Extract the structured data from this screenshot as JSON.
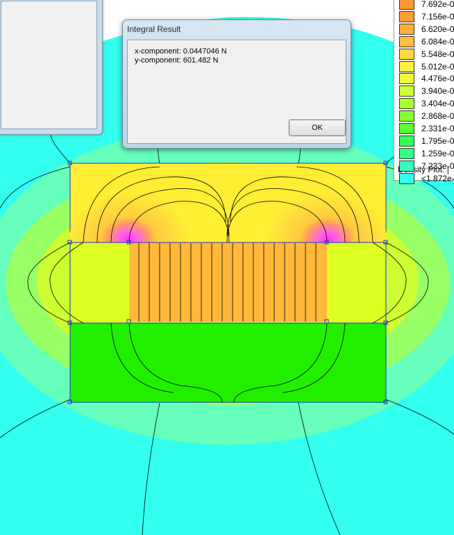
{
  "dialog": {
    "title": "Integral Result",
    "x_component": "x-component: 0.0447046 N",
    "y_component": "y-component: 601.482 N",
    "ok_label": "OK"
  },
  "legend": {
    "title": "Density Plot: |",
    "entries": [
      {
        "label": "7.692e-0",
        "color": "#ff9933"
      },
      {
        "label": "7.156e-0",
        "color": "#ffa033"
      },
      {
        "label": "6.620e-0",
        "color": "#ffae3a"
      },
      {
        "label": "6.084e-0",
        "color": "#ffc040"
      },
      {
        "label": "5.548e-0",
        "color": "#ffd840"
      },
      {
        "label": "5.012e-0",
        "color": "#fff040"
      },
      {
        "label": "4.476e-0",
        "color": "#eeff33"
      },
      {
        "label": "3.940e-0",
        "color": "#ccff33"
      },
      {
        "label": "3.404e-0",
        "color": "#aaff33"
      },
      {
        "label": "2.868e-0",
        "color": "#88ff33"
      },
      {
        "label": "2.331e-0",
        "color": "#55ff33"
      },
      {
        "label": "1.795e-0",
        "color": "#33ff55"
      },
      {
        "label": "1.259e-0",
        "color": "#33ff88"
      },
      {
        "label": "7.233e-0",
        "color": "#33ffbb"
      },
      {
        "label": "<1.872e-",
        "color": "#33ffee"
      }
    ]
  },
  "plot_colors": {
    "background": "#33ffee",
    "outer_halo": "#66ffbb",
    "mid_halo": "#99ff66",
    "top_iron": "#ffee33",
    "top_iron_core": "#ffb040",
    "hot_spot": "#ff33ff",
    "magnet": "#ffb83a",
    "magnet_side": "#ddff22",
    "bottom_iron": "#22ee00",
    "outline": "#1a33cc",
    "flux_line": "#000000"
  }
}
